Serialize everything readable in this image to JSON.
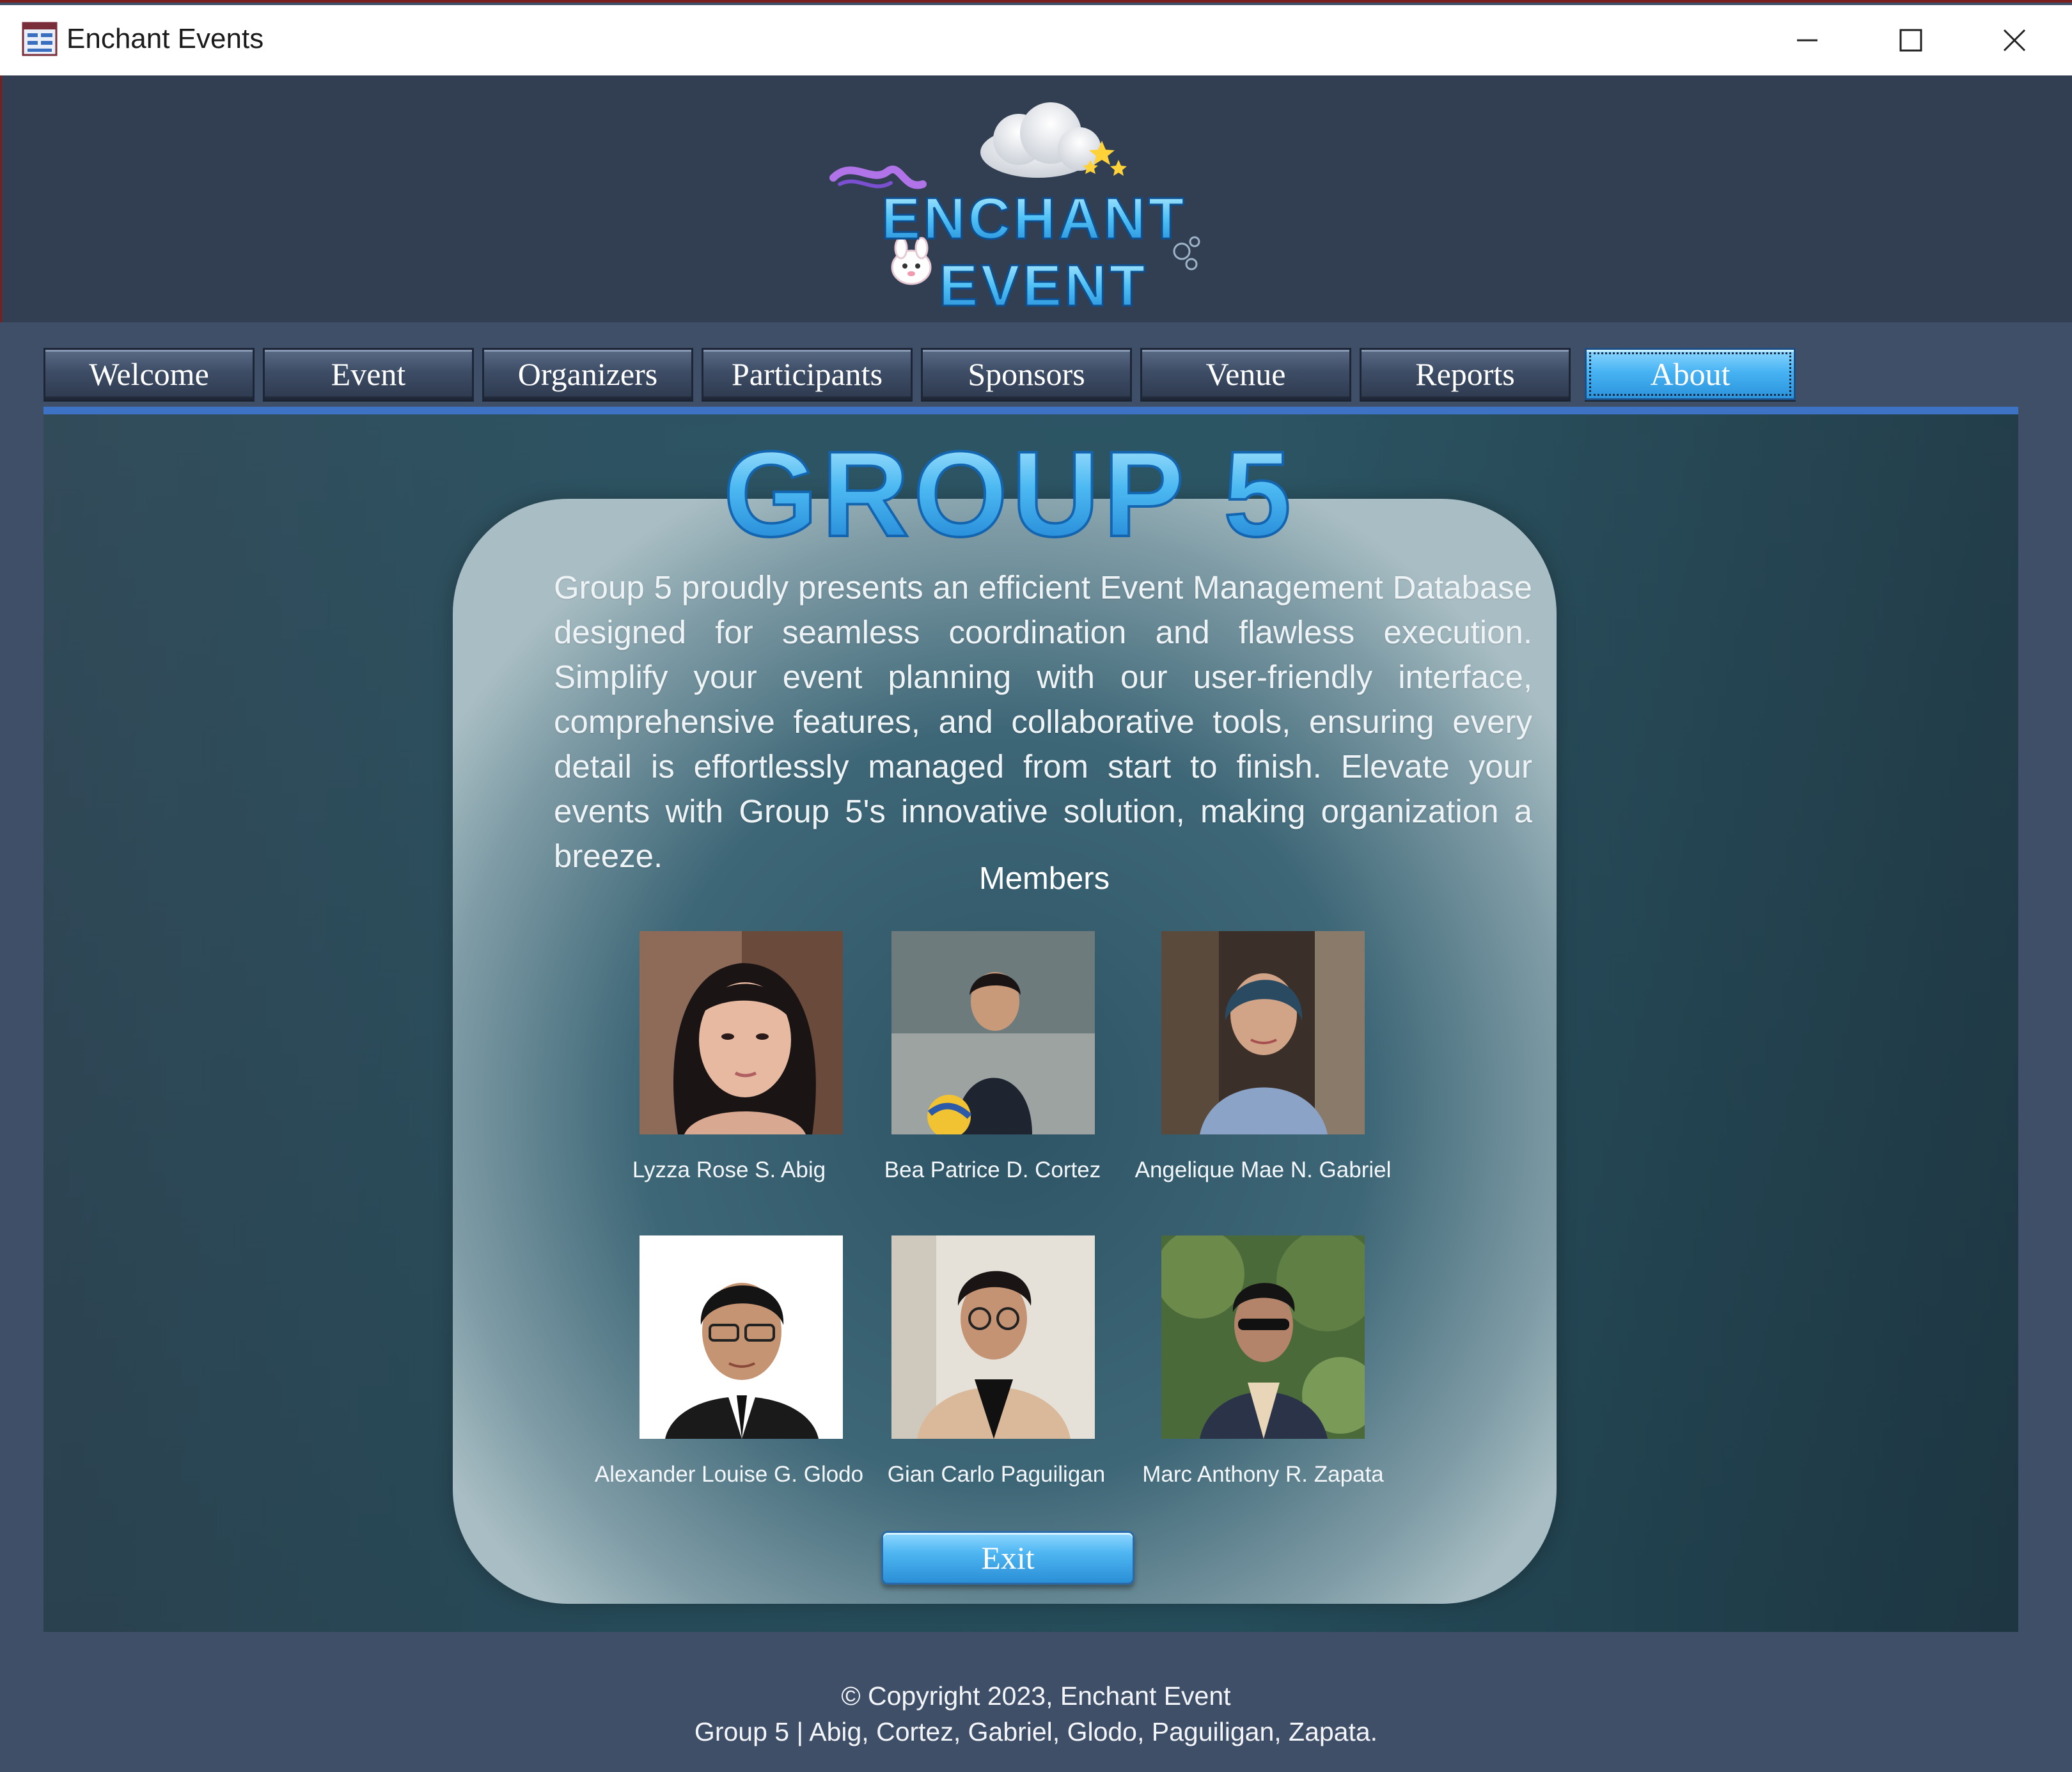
{
  "window": {
    "title": "Enchant Events",
    "minimize_icon": "minimize-icon",
    "maximize_icon": "maximize-icon",
    "close_icon": "close-icon"
  },
  "header": {
    "logo_line1": "ENCHANT",
    "logo_line2": "EVENT"
  },
  "tabs": [
    {
      "label": "Welcome",
      "active": false
    },
    {
      "label": "Event",
      "active": false
    },
    {
      "label": "Organizers",
      "active": false
    },
    {
      "label": "Participants",
      "active": false
    },
    {
      "label": "Sponsors",
      "active": false
    },
    {
      "label": "Venue",
      "active": false
    },
    {
      "label": "Reports",
      "active": false
    },
    {
      "label": "About",
      "active": true
    }
  ],
  "about": {
    "title": "GROUP 5",
    "description": "Group 5 proudly presents an efficient Event Management Database designed for seamless coordination and flawless execution. Simplify your event planning with our user-friendly interface, comprehensive features, and collaborative tools, ensuring every detail is effortlessly managed from start to finish. Elevate your events with Group 5's innovative solution, making organization a breeze.",
    "members_label": "Members",
    "members": [
      {
        "name": "Lyzza Rose S. Abig"
      },
      {
        "name": "Bea Patrice D. Cortez"
      },
      {
        "name": "Angelique Mae N. Gabriel"
      },
      {
        "name": "Alexander Louise G. Glodo"
      },
      {
        "name": "Gian Carlo Paguiligan"
      },
      {
        "name": "Marc Anthony R. Zapata"
      }
    ],
    "exit_label": "Exit"
  },
  "footer": {
    "line1": "© Copyright 2023, Enchant Event",
    "line2": "Group 5 | Abig, Cortez, Gabriel, Glodo, Paguiligan, Zapata."
  }
}
